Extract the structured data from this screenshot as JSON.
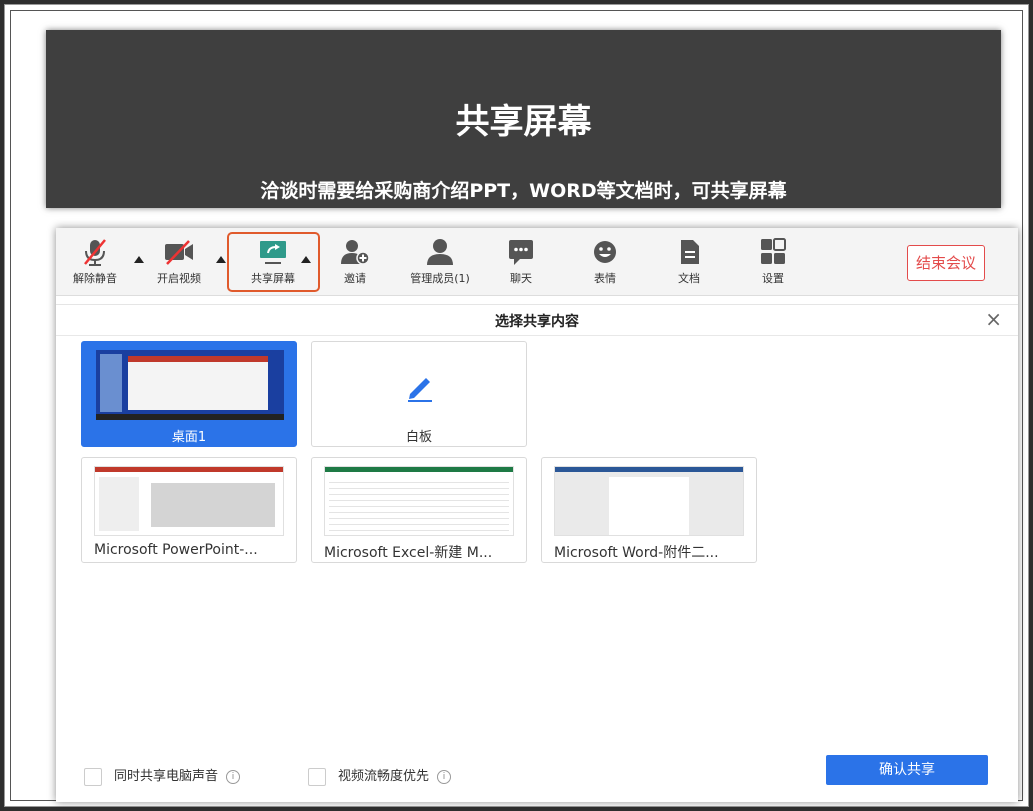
{
  "banner": {
    "title": "共享屏幕",
    "subtitle": "洽谈时需要给采购商介绍PPT，WORD等文档时，可共享屏幕"
  },
  "toolbar": {
    "items": [
      {
        "label": "解除静音",
        "icon": "mic-muted-icon"
      },
      {
        "label": "开启视频",
        "icon": "video-off-icon"
      },
      {
        "label": "共享屏幕",
        "icon": "share-screen-icon"
      },
      {
        "label": "邀请",
        "icon": "add-user-icon"
      },
      {
        "label": "管理成员(1)",
        "icon": "members-icon"
      },
      {
        "label": "聊天",
        "icon": "chat-icon"
      },
      {
        "label": "表情",
        "icon": "smile-icon"
      },
      {
        "label": "文档",
        "icon": "document-icon"
      },
      {
        "label": "设置",
        "icon": "settings-grid-icon"
      }
    ],
    "end_label": "结束会议",
    "active_color": "#e05a2c",
    "end_color": "#e34b4b"
  },
  "dialog": {
    "title": "选择共享内容",
    "close_symbol": "×",
    "sources": [
      {
        "label": "桌面1",
        "selected": true
      },
      {
        "label": "白板",
        "selected": false
      },
      {
        "label": "Microsoft PowerPoint-...",
        "selected": false
      },
      {
        "label": "Microsoft Excel-新建 M...",
        "selected": false
      },
      {
        "label": "Microsoft Word-附件二...",
        "selected": false
      }
    ],
    "options": [
      {
        "label": "同时共享电脑声音",
        "checked": false
      },
      {
        "label": "视频流畅度优先",
        "checked": false
      }
    ],
    "confirm_label": "确认共享",
    "accent_color": "#2b73e8"
  }
}
